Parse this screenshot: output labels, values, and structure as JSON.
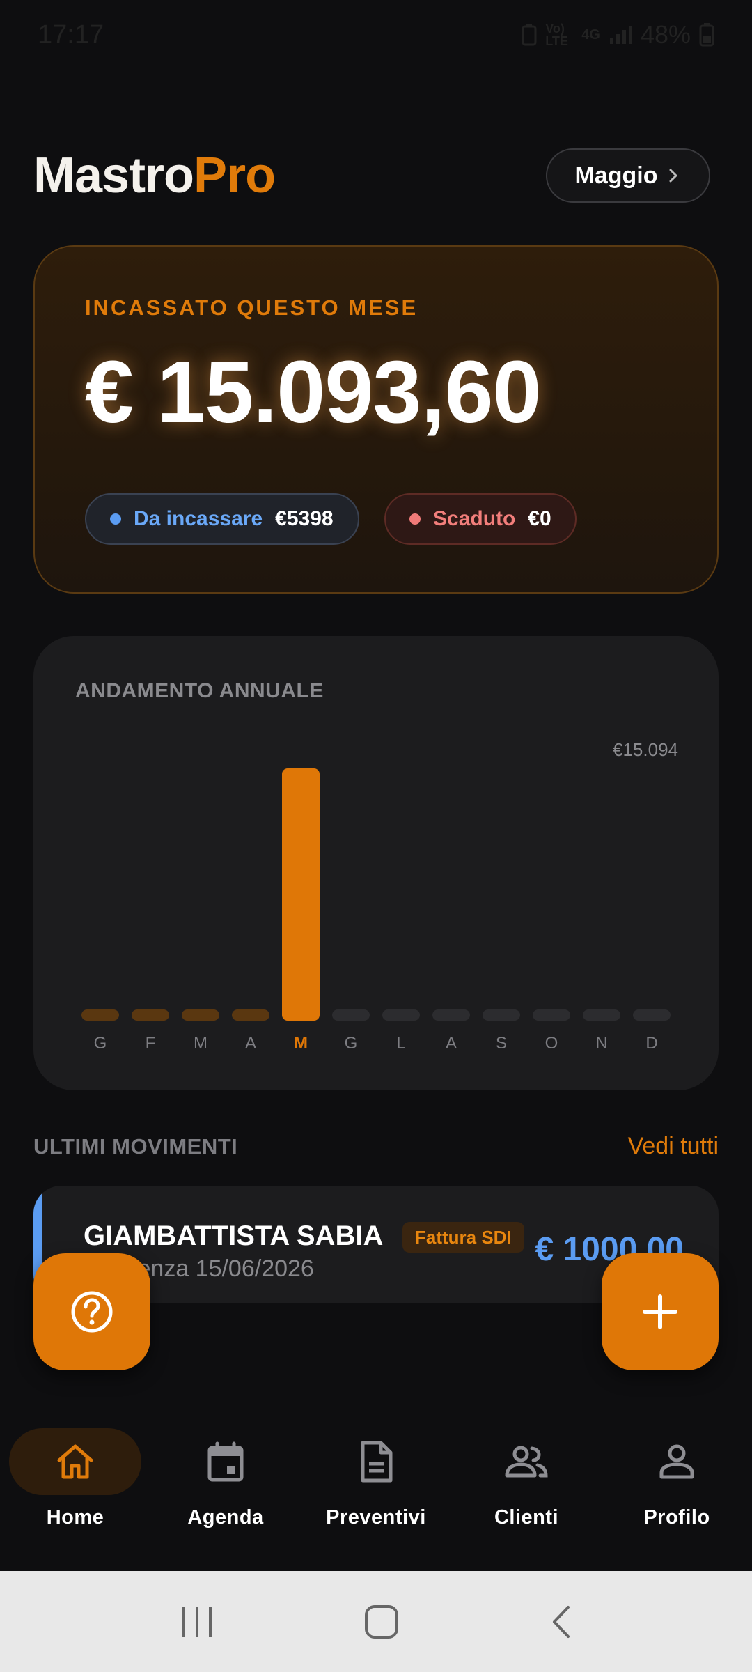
{
  "status_bar": {
    "time": "17:17",
    "network": "Vo) LTE",
    "network_gen": "4G",
    "battery": "48%"
  },
  "header": {
    "logo_part1": "Mastro",
    "logo_part2": "Pro",
    "month_button": "Maggio"
  },
  "hero": {
    "label": "INCASSATO QUESTO MESE",
    "amount": "€ 15.093,60",
    "pending_label": "Da incassare",
    "pending_value": "€5398",
    "overdue_label": "Scaduto",
    "overdue_value": "€0"
  },
  "chart_card": {
    "title": "ANDAMENTO ANNUALE",
    "max_label": "€15.094"
  },
  "chart_data": {
    "type": "bar",
    "title": "ANDAMENTO ANNUALE",
    "categories": [
      "G",
      "F",
      "M",
      "A",
      "M",
      "G",
      "L",
      "A",
      "S",
      "O",
      "N",
      "D"
    ],
    "values": [
      0,
      0,
      0,
      0,
      15093.6,
      0,
      0,
      0,
      0,
      0,
      0,
      0
    ],
    "highlight_index": 4,
    "ylim": [
      0,
      15094
    ],
    "max_label": "€15.094",
    "grid": false,
    "legend": "none",
    "colors": {
      "active": "#df7707",
      "past": "#5a3710",
      "future": "#2c2c2f"
    }
  },
  "movements": {
    "title": "ULTIMI MOVIMENTI",
    "see_all": "Vedi tutti",
    "items": [
      {
        "name": "GIAMBATTISTA SABIA",
        "tag": "Fattura SDI",
        "due": "Scadenza 15/06/2026",
        "amount": "€ 1000,00"
      }
    ]
  },
  "fab": {
    "help_icon": "help-circle-icon",
    "add_icon": "plus-icon"
  },
  "nav": {
    "items": [
      {
        "label": "Home",
        "icon": "home-icon",
        "active": true
      },
      {
        "label": "Agenda",
        "icon": "calendar-icon",
        "active": false
      },
      {
        "label": "Preventivi",
        "icon": "document-icon",
        "active": false
      },
      {
        "label": "Clienti",
        "icon": "people-icon",
        "active": false
      },
      {
        "label": "Profilo",
        "icon": "person-icon",
        "active": false
      }
    ]
  },
  "colors": {
    "accent": "#df7707",
    "blue": "#5b9cf2",
    "red": "#f07a78",
    "background": "#0e0e10",
    "card": "#1c1c1e"
  }
}
